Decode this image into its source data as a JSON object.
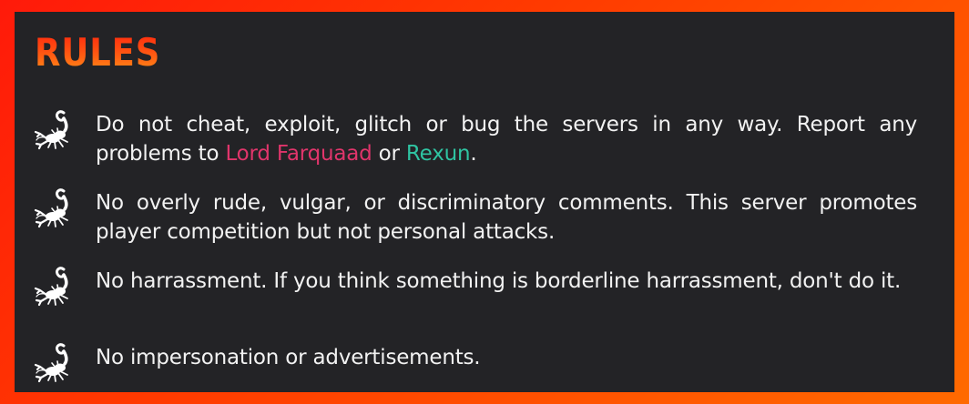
{
  "title": "RULES",
  "colors": {
    "border_gradient": [
      "#ff1a0a",
      "#ff6a00"
    ],
    "panel": "#232326",
    "title": "#ff4a12",
    "text": "#f2f2f2",
    "farquaad": "#e0356b",
    "rexun": "#2fc4a2"
  },
  "rules": [
    {
      "icon": "scorpion-icon",
      "before": "Do not cheat, exploit, glitch or bug the servers in any way. Report any problems to ",
      "name1": "Lord Farquaad",
      "middle": " or ",
      "name2": "Rexun",
      "after": "."
    },
    {
      "icon": "scorpion-icon",
      "text": "No overly rude, vulgar, or discriminatory comments. This server promotes player competition but not personal attacks."
    },
    {
      "icon": "scorpion-icon",
      "text": "No harrassment. If you think something is borderline harrassment, don't do it."
    },
    {
      "icon": "scorpion-icon",
      "text": "No impersonation or advertisements."
    }
  ]
}
